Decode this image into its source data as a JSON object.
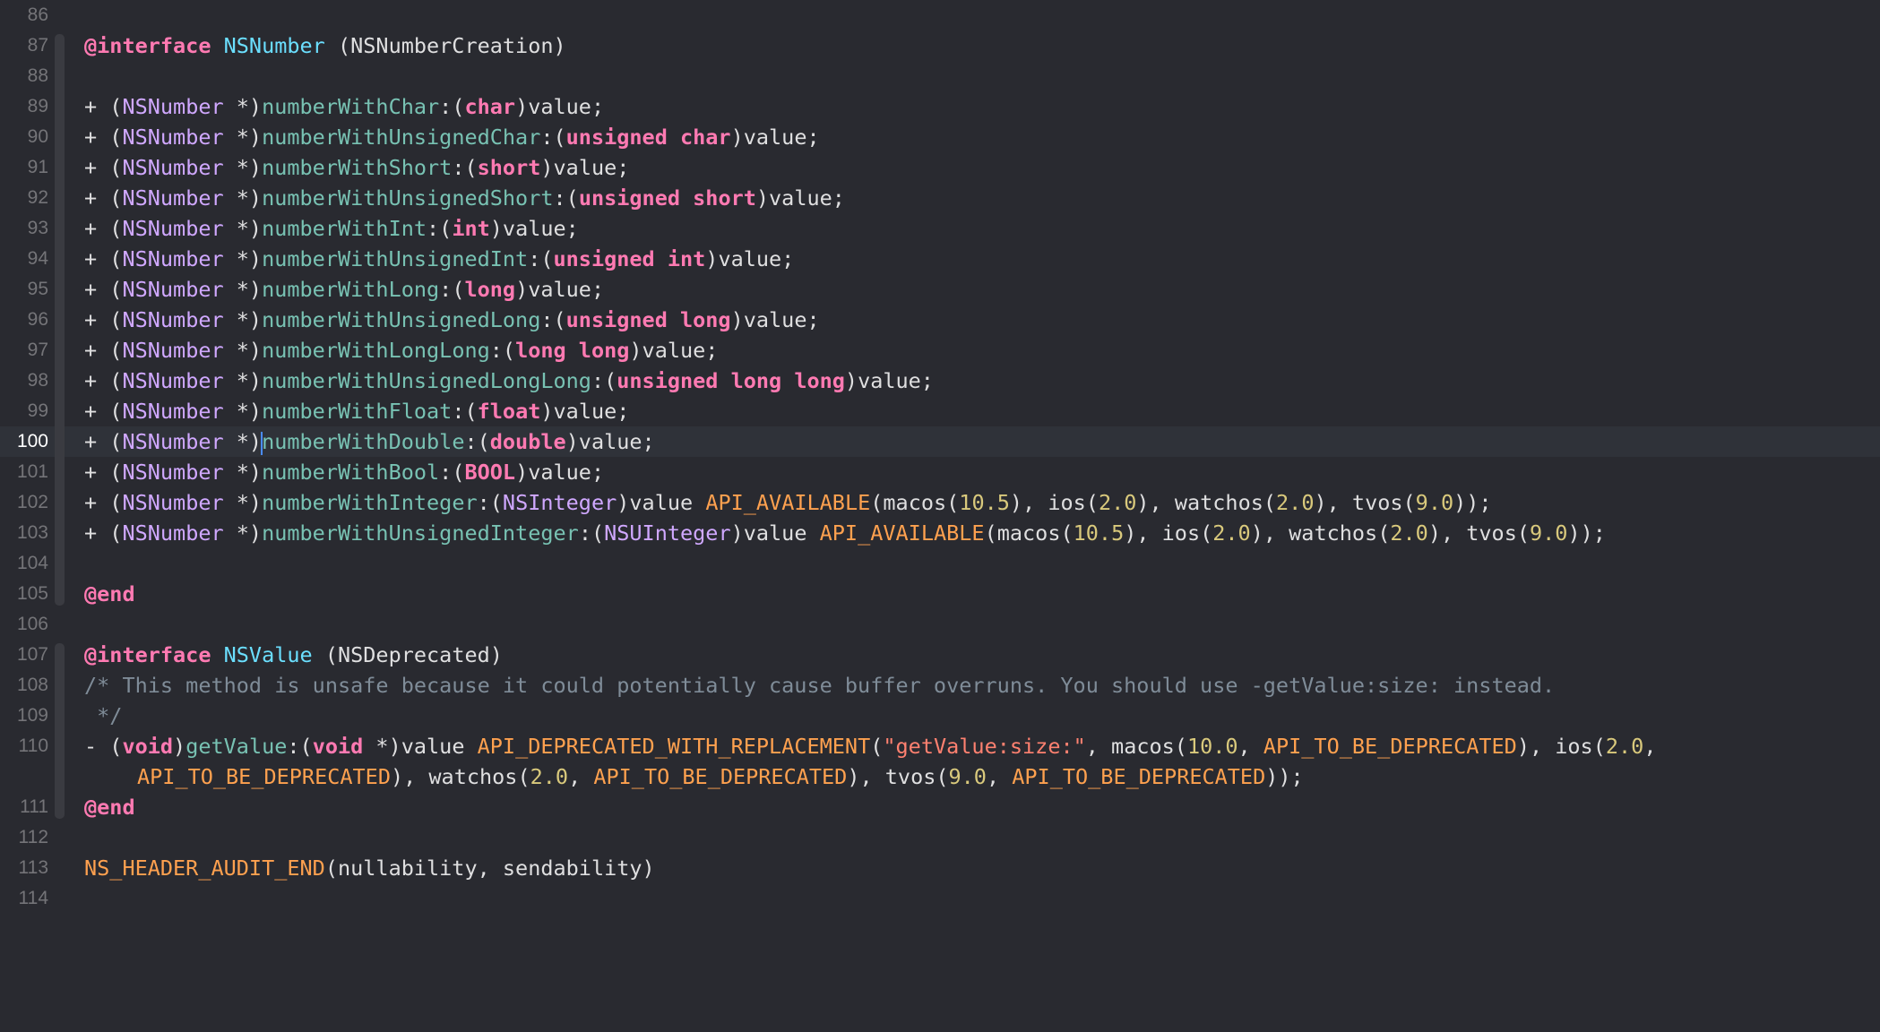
{
  "editor": {
    "current_line": 100,
    "lines": [
      {
        "n": "86",
        "tokens": []
      },
      {
        "n": "87",
        "tokens": [
          [
            "kw",
            "@interface"
          ],
          [
            "plain",
            " "
          ],
          [
            "cls",
            "NSNumber"
          ],
          [
            "plain",
            " (NSNumberCreation)"
          ]
        ]
      },
      {
        "n": "88",
        "tokens": []
      },
      {
        "n": "89",
        "tokens": [
          [
            "plain",
            "+ ("
          ],
          [
            "type",
            "NSNumber"
          ],
          [
            "plain",
            " *)"
          ],
          [
            "meth",
            "numberWithChar"
          ],
          [
            "plain",
            ":("
          ],
          [
            "kw",
            "char"
          ],
          [
            "plain",
            ")value;"
          ]
        ]
      },
      {
        "n": "90",
        "tokens": [
          [
            "plain",
            "+ ("
          ],
          [
            "type",
            "NSNumber"
          ],
          [
            "plain",
            " *)"
          ],
          [
            "meth",
            "numberWithUnsignedChar"
          ],
          [
            "plain",
            ":("
          ],
          [
            "kw",
            "unsigned char"
          ],
          [
            "plain",
            ")value;"
          ]
        ]
      },
      {
        "n": "91",
        "tokens": [
          [
            "plain",
            "+ ("
          ],
          [
            "type",
            "NSNumber"
          ],
          [
            "plain",
            " *)"
          ],
          [
            "meth",
            "numberWithShort"
          ],
          [
            "plain",
            ":("
          ],
          [
            "kw",
            "short"
          ],
          [
            "plain",
            ")value;"
          ]
        ]
      },
      {
        "n": "92",
        "tokens": [
          [
            "plain",
            "+ ("
          ],
          [
            "type",
            "NSNumber"
          ],
          [
            "plain",
            " *)"
          ],
          [
            "meth",
            "numberWithUnsignedShort"
          ],
          [
            "plain",
            ":("
          ],
          [
            "kw",
            "unsigned short"
          ],
          [
            "plain",
            ")value;"
          ]
        ]
      },
      {
        "n": "93",
        "tokens": [
          [
            "plain",
            "+ ("
          ],
          [
            "type",
            "NSNumber"
          ],
          [
            "plain",
            " *)"
          ],
          [
            "meth",
            "numberWithInt"
          ],
          [
            "plain",
            ":("
          ],
          [
            "kw",
            "int"
          ],
          [
            "plain",
            ")value;"
          ]
        ]
      },
      {
        "n": "94",
        "tokens": [
          [
            "plain",
            "+ ("
          ],
          [
            "type",
            "NSNumber"
          ],
          [
            "plain",
            " *)"
          ],
          [
            "meth",
            "numberWithUnsignedInt"
          ],
          [
            "plain",
            ":("
          ],
          [
            "kw",
            "unsigned int"
          ],
          [
            "plain",
            ")value;"
          ]
        ]
      },
      {
        "n": "95",
        "tokens": [
          [
            "plain",
            "+ ("
          ],
          [
            "type",
            "NSNumber"
          ],
          [
            "plain",
            " *)"
          ],
          [
            "meth",
            "numberWithLong"
          ],
          [
            "plain",
            ":("
          ],
          [
            "kw",
            "long"
          ],
          [
            "plain",
            ")value;"
          ]
        ]
      },
      {
        "n": "96",
        "tokens": [
          [
            "plain",
            "+ ("
          ],
          [
            "type",
            "NSNumber"
          ],
          [
            "plain",
            " *)"
          ],
          [
            "meth",
            "numberWithUnsignedLong"
          ],
          [
            "plain",
            ":("
          ],
          [
            "kw",
            "unsigned long"
          ],
          [
            "plain",
            ")value;"
          ]
        ]
      },
      {
        "n": "97",
        "tokens": [
          [
            "plain",
            "+ ("
          ],
          [
            "type",
            "NSNumber"
          ],
          [
            "plain",
            " *)"
          ],
          [
            "meth",
            "numberWithLongLong"
          ],
          [
            "plain",
            ":("
          ],
          [
            "kw",
            "long long"
          ],
          [
            "plain",
            ")value;"
          ]
        ]
      },
      {
        "n": "98",
        "tokens": [
          [
            "plain",
            "+ ("
          ],
          [
            "type",
            "NSNumber"
          ],
          [
            "plain",
            " *)"
          ],
          [
            "meth",
            "numberWithUnsignedLongLong"
          ],
          [
            "plain",
            ":("
          ],
          [
            "kw",
            "unsigned long long"
          ],
          [
            "plain",
            ")value;"
          ]
        ]
      },
      {
        "n": "99",
        "tokens": [
          [
            "plain",
            "+ ("
          ],
          [
            "type",
            "NSNumber"
          ],
          [
            "plain",
            " *)"
          ],
          [
            "meth",
            "numberWithFloat"
          ],
          [
            "plain",
            ":("
          ],
          [
            "kw",
            "float"
          ],
          [
            "plain",
            ")value;"
          ]
        ]
      },
      {
        "n": "100",
        "tokens": [
          [
            "plain",
            "+ ("
          ],
          [
            "type",
            "NSNumber"
          ],
          [
            "plain",
            " *)"
          ],
          [
            "caret",
            ""
          ],
          [
            "meth",
            "numberWithDouble"
          ],
          [
            "plain",
            ":("
          ],
          [
            "kw",
            "double"
          ],
          [
            "plain",
            ")value;"
          ]
        ]
      },
      {
        "n": "101",
        "tokens": [
          [
            "plain",
            "+ ("
          ],
          [
            "type",
            "NSNumber"
          ],
          [
            "plain",
            " *)"
          ],
          [
            "meth",
            "numberWithBool"
          ],
          [
            "plain",
            ":("
          ],
          [
            "kw",
            "BOOL"
          ],
          [
            "plain",
            ")value;"
          ]
        ]
      },
      {
        "n": "102",
        "tokens": [
          [
            "plain",
            "+ ("
          ],
          [
            "type",
            "NSNumber"
          ],
          [
            "plain",
            " *)"
          ],
          [
            "meth",
            "numberWithInteger"
          ],
          [
            "plain",
            ":("
          ],
          [
            "type",
            "NSInteger"
          ],
          [
            "plain",
            ")value "
          ],
          [
            "macro",
            "API_AVAILABLE"
          ],
          [
            "plain",
            "(macos("
          ],
          [
            "num",
            "10.5"
          ],
          [
            "plain",
            "), ios("
          ],
          [
            "num",
            "2.0"
          ],
          [
            "plain",
            "), watchos("
          ],
          [
            "num",
            "2.0"
          ],
          [
            "plain",
            "), tvos("
          ],
          [
            "num",
            "9.0"
          ],
          [
            "plain",
            "));"
          ]
        ]
      },
      {
        "n": "103",
        "tokens": [
          [
            "plain",
            "+ ("
          ],
          [
            "type",
            "NSNumber"
          ],
          [
            "plain",
            " *)"
          ],
          [
            "meth",
            "numberWithUnsignedInteger"
          ],
          [
            "plain",
            ":("
          ],
          [
            "type",
            "NSUInteger"
          ],
          [
            "plain",
            ")value "
          ],
          [
            "macro",
            "API_AVAILABLE"
          ],
          [
            "plain",
            "(macos("
          ],
          [
            "num",
            "10.5"
          ],
          [
            "plain",
            "), ios("
          ],
          [
            "num",
            "2.0"
          ],
          [
            "plain",
            "), watchos("
          ],
          [
            "num",
            "2.0"
          ],
          [
            "plain",
            "), tvos("
          ],
          [
            "num",
            "9.0"
          ],
          [
            "plain",
            "));"
          ]
        ]
      },
      {
        "n": "104",
        "tokens": []
      },
      {
        "n": "105",
        "tokens": [
          [
            "kw",
            "@end"
          ]
        ]
      },
      {
        "n": "106",
        "tokens": []
      },
      {
        "n": "107",
        "tokens": [
          [
            "kw",
            "@interface"
          ],
          [
            "plain",
            " "
          ],
          [
            "cls",
            "NSValue"
          ],
          [
            "plain",
            " (NSDeprecated)"
          ]
        ]
      },
      {
        "n": "108",
        "tokens": [
          [
            "cmt",
            "/* This method is unsafe because it could potentially cause buffer overruns. You should use -getValue:size: instead."
          ]
        ]
      },
      {
        "n": "109",
        "tokens": [
          [
            "cmt",
            " */"
          ]
        ]
      },
      {
        "n": "110",
        "tokens": [
          [
            "plain",
            "- ("
          ],
          [
            "kw",
            "void"
          ],
          [
            "plain",
            ")"
          ],
          [
            "meth",
            "getValue"
          ],
          [
            "plain",
            ":("
          ],
          [
            "kw",
            "void"
          ],
          [
            "plain",
            " *)value "
          ],
          [
            "macro",
            "API_DEPRECATED_WITH_REPLACEMENT"
          ],
          [
            "plain",
            "("
          ],
          [
            "str",
            "\"getValue:size:\""
          ],
          [
            "plain",
            ", macos("
          ],
          [
            "num",
            "10.0"
          ],
          [
            "plain",
            ", "
          ],
          [
            "macro",
            "API_TO_BE_DEPRECATED"
          ],
          [
            "plain",
            "), ios("
          ],
          [
            "num",
            "2.0"
          ],
          [
            "plain",
            ","
          ]
        ]
      },
      {
        "n": "",
        "cont": true,
        "tokens": [
          [
            "macro",
            "API_TO_BE_DEPRECATED"
          ],
          [
            "plain",
            "), watchos("
          ],
          [
            "num",
            "2.0"
          ],
          [
            "plain",
            ", "
          ],
          [
            "macro",
            "API_TO_BE_DEPRECATED"
          ],
          [
            "plain",
            "), tvos("
          ],
          [
            "num",
            "9.0"
          ],
          [
            "plain",
            ", "
          ],
          [
            "macro",
            "API_TO_BE_DEPRECATED"
          ],
          [
            "plain",
            "));"
          ]
        ]
      },
      {
        "n": "111",
        "tokens": [
          [
            "kw",
            "@end"
          ]
        ]
      },
      {
        "n": "112",
        "tokens": []
      },
      {
        "n": "113",
        "tokens": [
          [
            "macro",
            "NS_HEADER_AUDIT_END"
          ],
          [
            "plain",
            "(nullability, sendability)"
          ]
        ]
      },
      {
        "n": "114",
        "tokens": []
      }
    ]
  },
  "colors": {
    "background": "#292a30",
    "current_line": "#2f3239",
    "keyword": "#ff7ab2",
    "class_name": "#6bdfff",
    "type_name": "#d0a8ff",
    "method": "#78c2b3",
    "macro": "#ffa14f",
    "number": "#d9c97c",
    "string": "#ff8170",
    "comment": "#7f8c98",
    "caret": "#4a8cff"
  }
}
